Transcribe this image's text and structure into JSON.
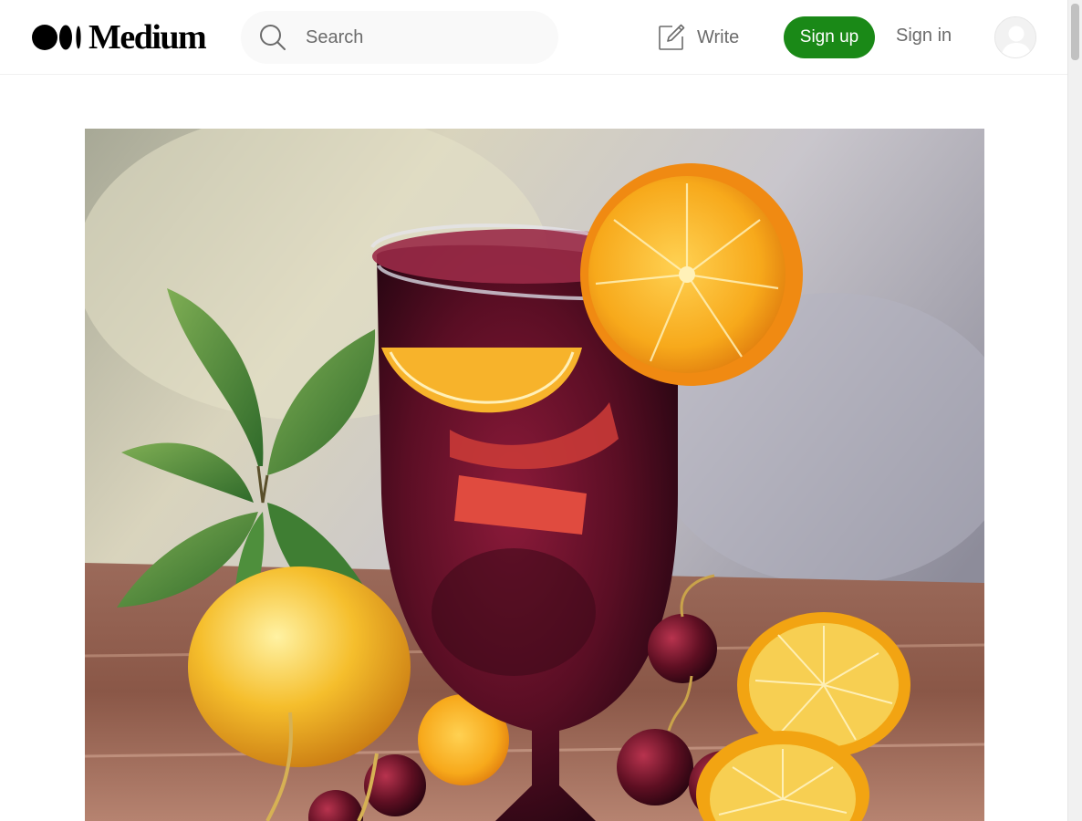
{
  "header": {
    "logo_text": "Medium",
    "search": {
      "placeholder": "Search",
      "value": ""
    },
    "write_label": "Write",
    "signup_label": "Sign up",
    "signin_label": "Sign in"
  },
  "icons": {
    "logo_mark": "medium-logo-icon",
    "search": "search-icon",
    "write": "write-icon",
    "avatar": "user-avatar-icon"
  },
  "colors": {
    "accent": "#1a8917",
    "text_muted": "#6b6b6b",
    "search_bg": "#f9f9f9"
  },
  "article": {
    "hero_image_alt": "Painting of a glass of red sangria with orange slices, cherries, lemons and mint leaves"
  }
}
